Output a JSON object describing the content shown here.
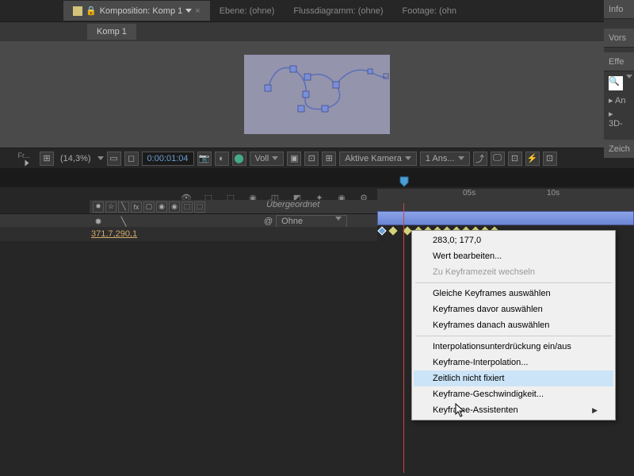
{
  "main_tabs": {
    "comp_label": "Komposition: Komp 1",
    "layer_label": "Ebene: (ohne)",
    "flow_label": "Flussdiagramm: (ohne)",
    "footage_label": "Footage: (ohn"
  },
  "sub_tab": "Komp 1",
  "viewer": {
    "zoom": "(14,3%)",
    "time": "0:00:01:04",
    "mode": "Voll",
    "camera": "Aktive Kamera",
    "views": "1 Ans..."
  },
  "right_panel": {
    "info": "Info",
    "vors": "Vors",
    "eff": "Effe",
    "an": "An",
    "threed": "3D-",
    "zeich": "Zeich"
  },
  "timeline": {
    "parent_header": "Übergeordnet",
    "parent_value": "Ohne",
    "position_value": "371,7,290,1",
    "ruler": {
      "t1": "05s",
      "t2": "10s"
    }
  },
  "context_menu": {
    "items": [
      {
        "label": "283,0; 177,0",
        "disabled": false
      },
      {
        "label": "Wert bearbeiten...",
        "disabled": false
      },
      {
        "label": "Zu Keyframezeit wechseln",
        "disabled": true
      },
      {
        "sep": true
      },
      {
        "label": "Gleiche Keyframes auswählen",
        "disabled": false
      },
      {
        "label": "Keyframes davor auswählen",
        "disabled": false
      },
      {
        "label": "Keyframes danach auswählen",
        "disabled": false
      },
      {
        "sep": true
      },
      {
        "label": "Interpolationsunterdrückung ein/aus",
        "disabled": false
      },
      {
        "label": "Keyframe-Interpolation...",
        "disabled": false
      },
      {
        "label": "Zeitlich nicht fixiert",
        "disabled": false,
        "highlighted": true
      },
      {
        "label": "Keyframe-Geschwindigkeit...",
        "disabled": false
      },
      {
        "label": "Keyframe-Assistenten",
        "disabled": false,
        "submenu": true
      }
    ]
  }
}
